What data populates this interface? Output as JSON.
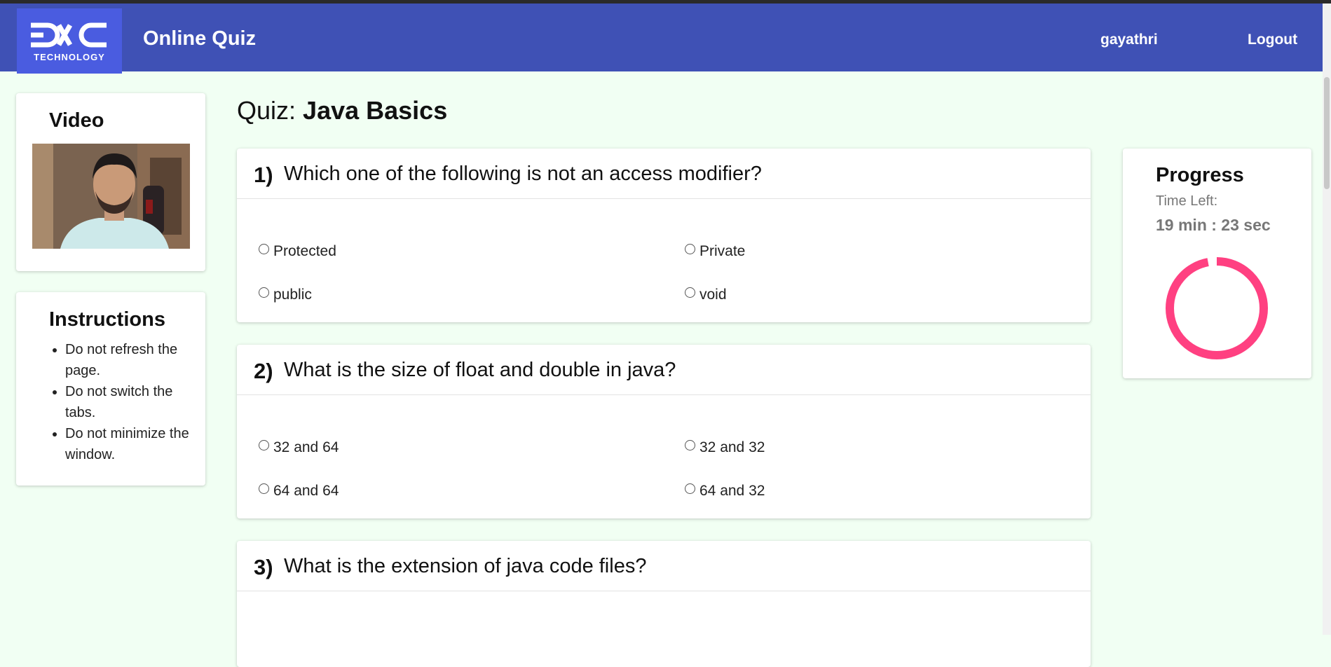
{
  "header": {
    "logo_text": "DXC",
    "logo_subtext": "TECHNOLOGY",
    "app_title": "Online Quiz",
    "username": "gayathri",
    "logout_label": "Logout"
  },
  "video_panel": {
    "title": "Video"
  },
  "instructions_panel": {
    "title": "Instructions",
    "items": [
      "Do not refresh the page.",
      "Do not switch the tabs.",
      "Do not minimize the window."
    ]
  },
  "quiz": {
    "prefix": "Quiz:",
    "name": "Java Basics",
    "questions": [
      {
        "number": "1)",
        "text": "Which one of the following is not an access modifier?",
        "options": [
          "Protected",
          "Private",
          "public",
          "void"
        ]
      },
      {
        "number": "2)",
        "text": "What is the size of float and double in java?",
        "options": [
          "32 and 64",
          "32 and 32",
          "64 and 64",
          "64 and 32"
        ]
      },
      {
        "number": "3)",
        "text": "What is the extension of java code files?",
        "options": []
      }
    ]
  },
  "progress_panel": {
    "title": "Progress",
    "time_left_label": "Time Left:",
    "time_left_value": "19 min : 23 sec",
    "ring_fraction": 0.97,
    "ring_color": "#ff4081"
  },
  "colors": {
    "navbar": "#3f51b5",
    "page_background": "#f1fff3",
    "logo_background": "#4a5ce0"
  }
}
